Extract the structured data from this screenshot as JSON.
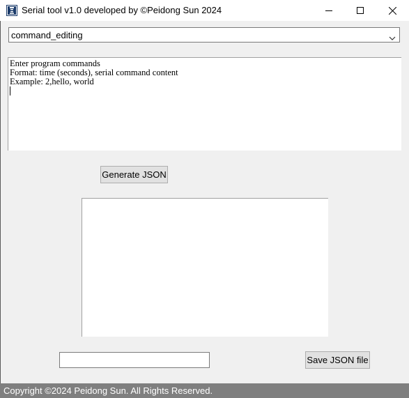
{
  "window": {
    "title": "Serial tool v1.0 developed by ©Peidong Sun 2024",
    "icon": "app-icon",
    "controls": [
      "minimize-icon",
      "maximize-icon",
      "close-icon"
    ]
  },
  "mode_select": {
    "selected": "command_editing"
  },
  "editor": {
    "lines": [
      "Enter program commands",
      "Format: time (seconds), serial command content",
      "Example: 2,hello, world"
    ]
  },
  "generate_button": {
    "label": "Generate JSON"
  },
  "output": {
    "value": ""
  },
  "filename_input": {
    "value": ""
  },
  "save_button": {
    "label": "Save JSON file"
  },
  "status_bar": {
    "text": "Copyright ©2024 Peidong Sun. All Rights Reserved."
  },
  "colors": {
    "window_bg": "#f0f0f0",
    "status_bar_bg": "#7f7f7f",
    "status_text": "#ffffff",
    "button_bg": "#e1e1e1"
  }
}
